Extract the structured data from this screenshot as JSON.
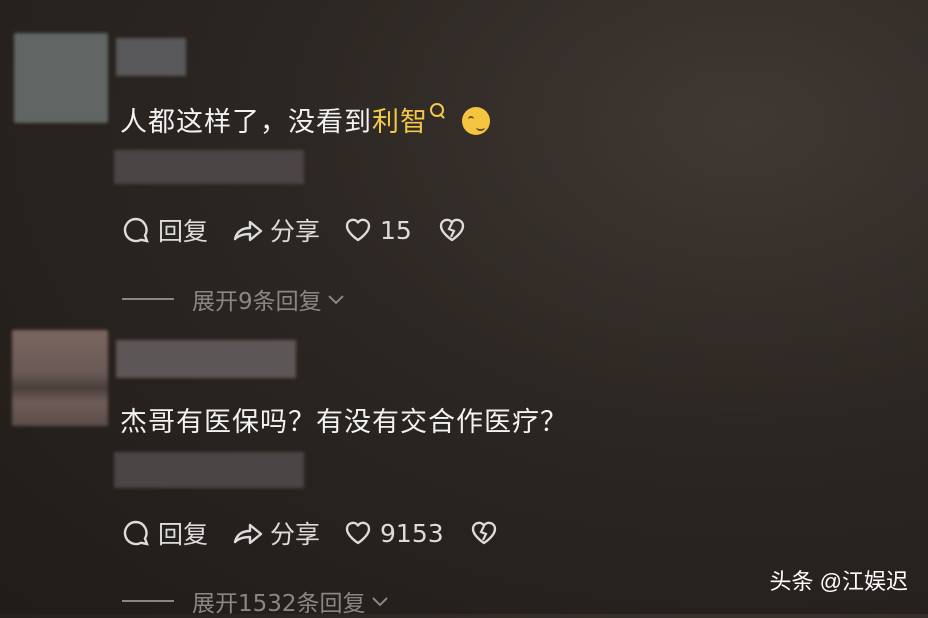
{
  "comments": [
    {
      "text_main": "人都这样了，没看到",
      "text_highlight": "利智",
      "actions": {
        "reply": "回复",
        "share": "分享",
        "likes": "15"
      },
      "expand_label": "展开9条回复"
    },
    {
      "text_main": "杰哥有医保吗？有没有交合作医疗？",
      "actions": {
        "reply": "回复",
        "share": "分享",
        "likes": "9153"
      },
      "expand_label": "展开1532条回复"
    }
  ],
  "watermark": "头条 @江娱迟",
  "colors": {
    "highlight": "#f3c948",
    "background": "#2c2622",
    "muted": "#8c8682"
  }
}
